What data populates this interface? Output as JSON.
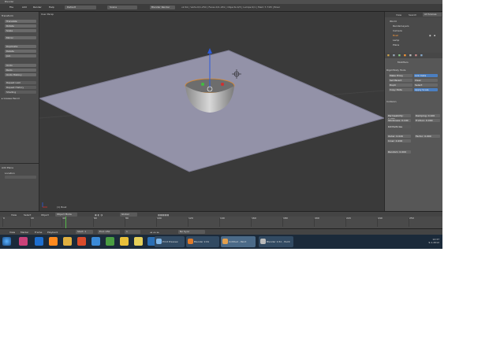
{
  "window": {
    "title": "Blender"
  },
  "info_header": {
    "menus": [
      "File",
      "Add",
      "Render",
      "Help"
    ],
    "screen_layout": "Default",
    "scene": "Scene",
    "render_engine": "Blender Render",
    "stats": "v2.61 | Verts:0/1,250 | Faces:0/1,181 | Objects:0/3 | Lamps:0/1 | Mem:7.71M | Bowl"
  },
  "tool_shelf": {
    "section_transform": "Transform",
    "buttons": [
      "Translate",
      "Rotate",
      "Scale",
      "Mirror"
    ],
    "edit_buttons": [
      "Duplicate",
      "Delete",
      "Join"
    ],
    "history_buttons": [
      "Undo",
      "Redo",
      "Undo History",
      "Repeat Last",
      "Repeat History"
    ],
    "shading": "Shading",
    "last_op_title": "Add Plane",
    "last_op_field": "Location"
  },
  "viewport": {
    "label": "User Persp",
    "object_label": "(1) Bowl",
    "mode": "Object Mode",
    "pivot": "Global"
  },
  "outliner": {
    "items": [
      "World",
      "RenderLayers",
      "Camera",
      "Bowl",
      "Lamp",
      "Plane"
    ]
  },
  "properties": {
    "tabs_selected": "Modifiers",
    "section_title": "Rigid Body Tools",
    "buttons": [
      {
        "label": "Make Proxy",
        "hl": false
      },
      {
        "label": "Link Data",
        "hl": true
      },
      {
        "label": "Set Parent",
        "hl": false
      },
      {
        "label": "Clear",
        "hl": false
      },
      {
        "label": "Dupli",
        "hl": false
      },
      {
        "label": "Select",
        "hl": false
      },
      {
        "label": "Copy Data",
        "hl": false
      },
      {
        "label": "Apply Scale",
        "hl": false
      }
    ],
    "section2_title": "Collision",
    "fields": [
      {
        "label": "Permeability: 0.000"
      },
      {
        "label": "Stickiness: 0.100"
      },
      {
        "label": "Kill Particles"
      },
      {
        "label": "Outer: 0.020"
      },
      {
        "label": "Inner: 0.200"
      },
      {
        "label": "Damping: 0.100"
      },
      {
        "label": "Friction: 0.000"
      },
      {
        "label": "Factor: 0.000"
      },
      {
        "label": "Random: 0.000"
      }
    ]
  },
  "view3d_header": {
    "menus": [
      "View",
      "Select",
      "Object"
    ],
    "mode": "Object Mode",
    "pivot": "Global"
  },
  "timeline": {
    "ticks": [
      "0",
      "20",
      "40",
      "60",
      "80",
      "100",
      "120",
      "140",
      "160",
      "180",
      "200",
      "220",
      "240",
      "250"
    ],
    "menus": [
      "View",
      "Marker",
      "Frame",
      "Playback"
    ],
    "start": "Start: 1",
    "end": "End: 250",
    "current": "1",
    "keying": "No Sync"
  },
  "taskbar": {
    "tasks": [
      "Print Preview",
      "Blender 2.61",
      "Untitled - Paint",
      "Blender 2.61 - Paint"
    ],
    "time": "12:37",
    "date": "9-1-2012"
  }
}
